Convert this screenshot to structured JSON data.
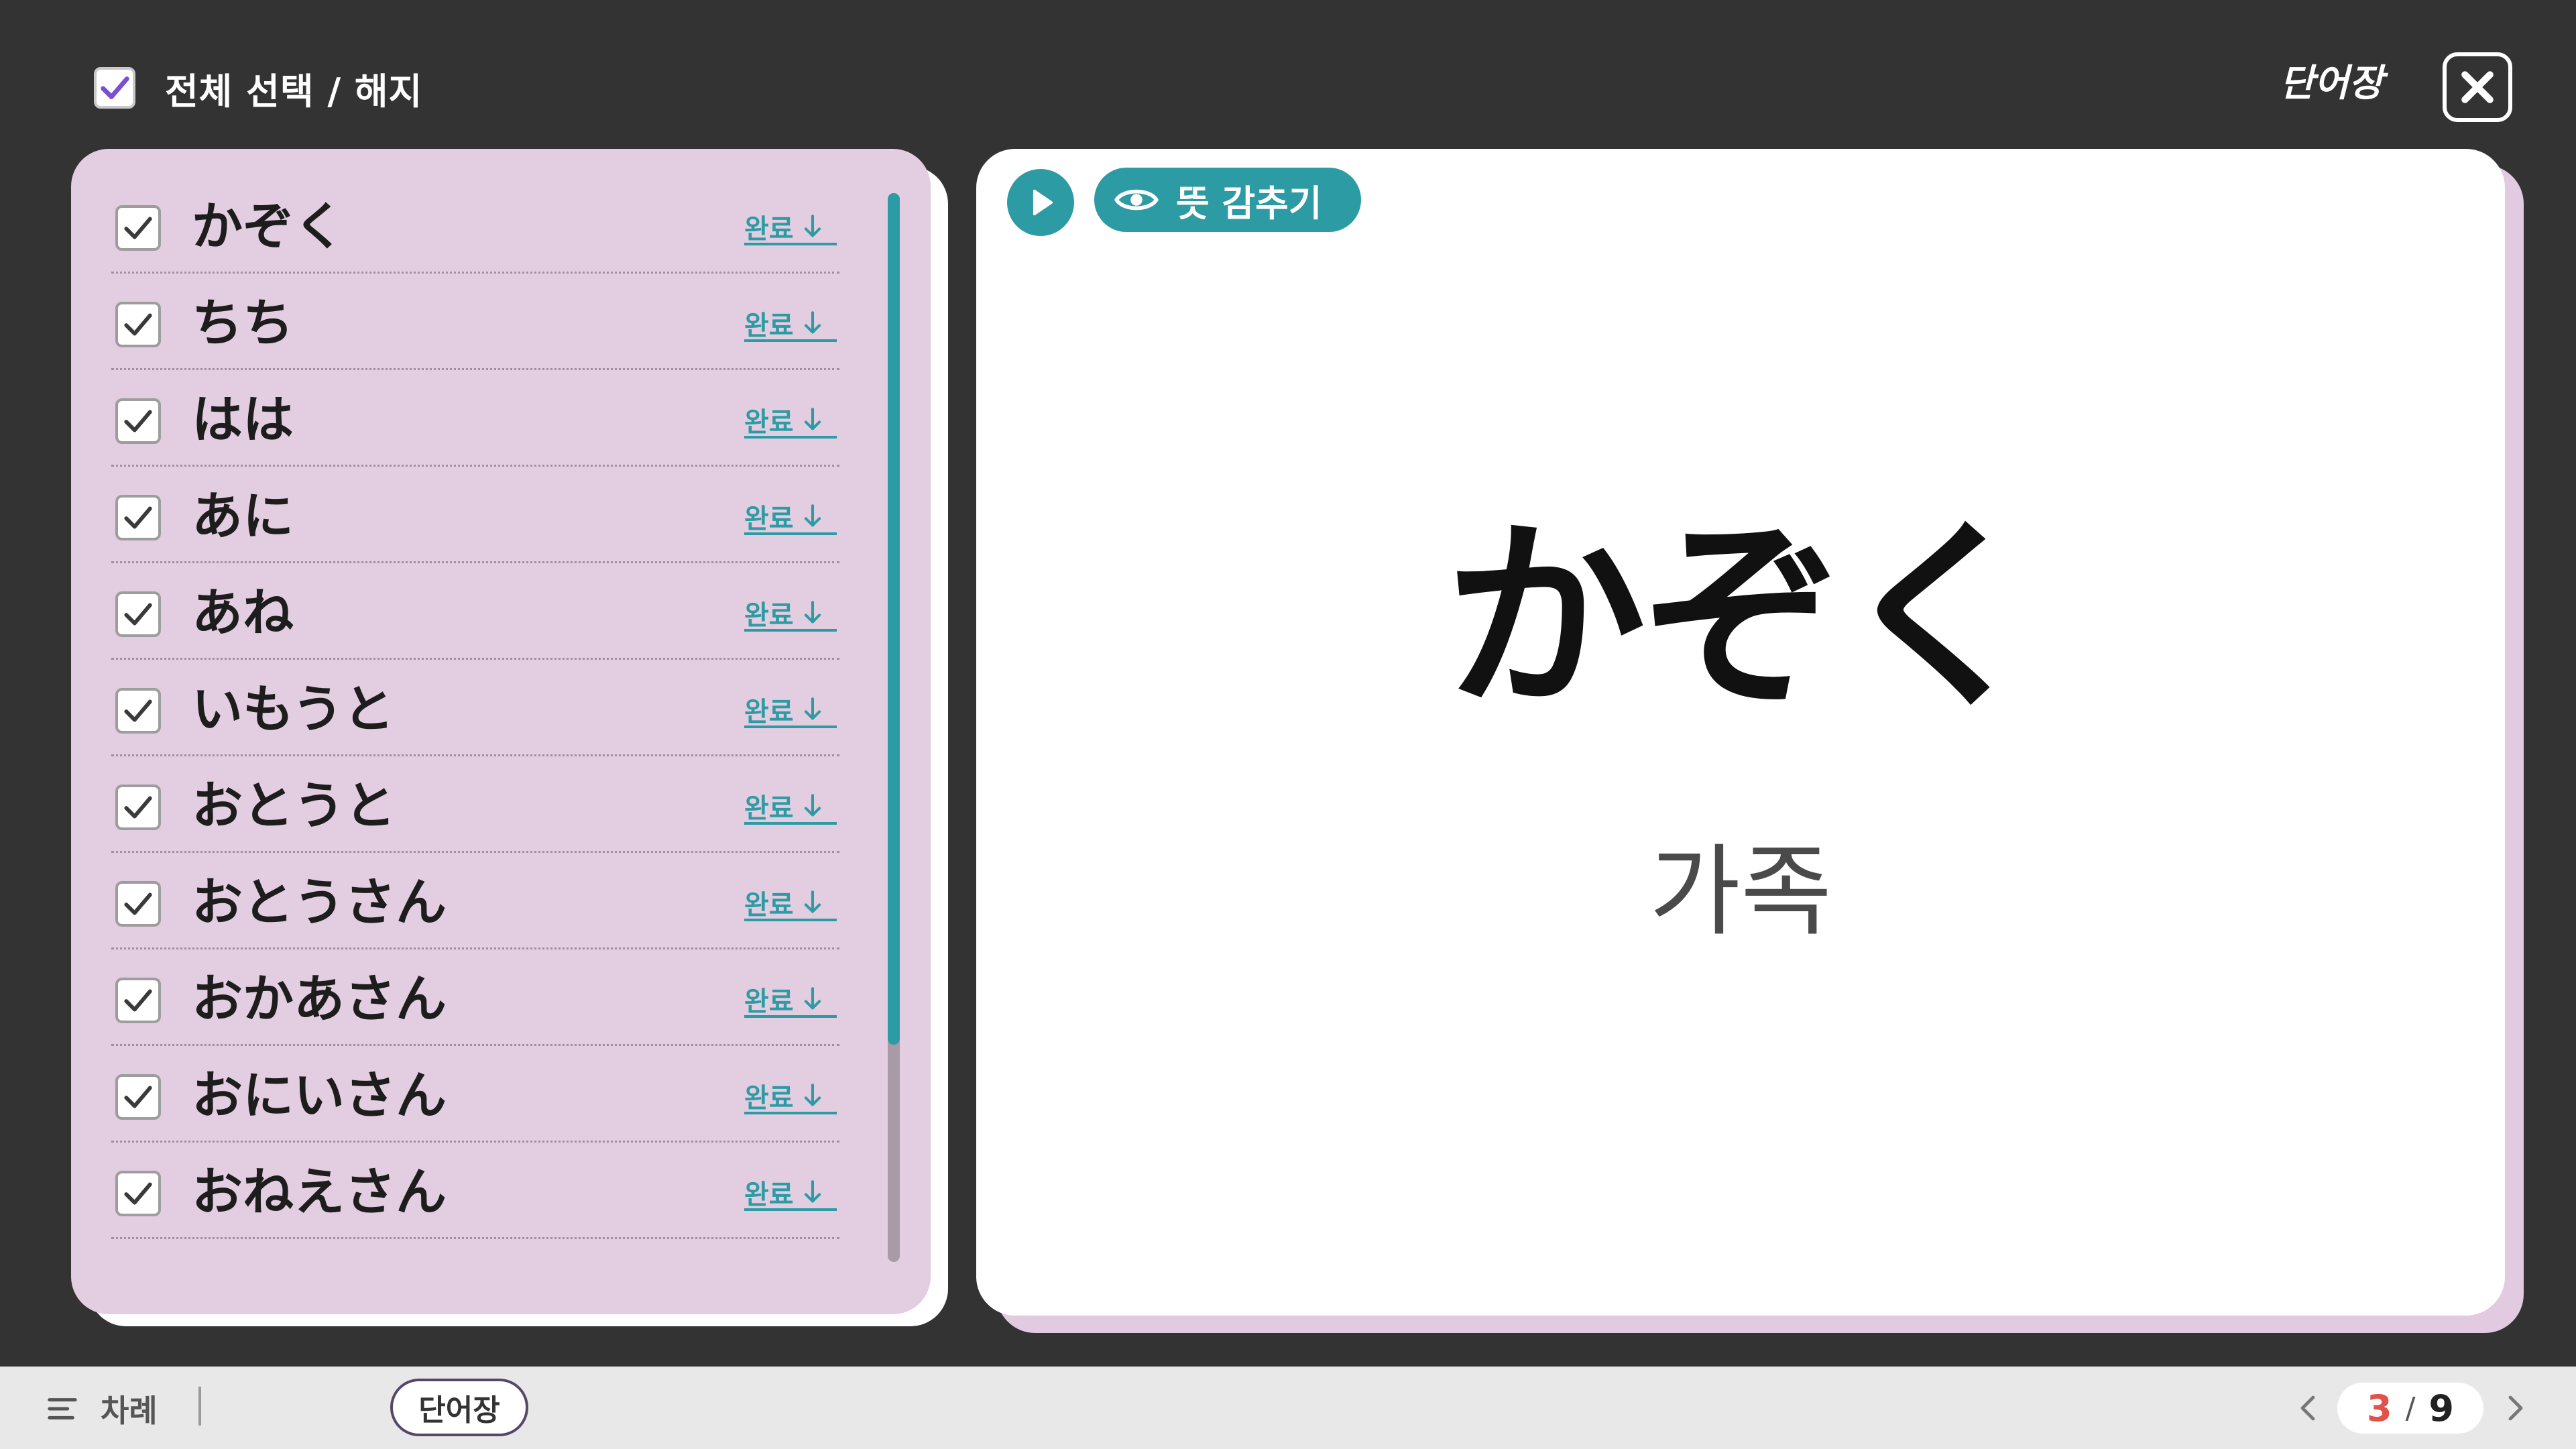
{
  "header": {
    "select_all_label": "전체 선택 / 해지",
    "brand_title": "단어장"
  },
  "word_list": [
    {
      "word": "かぞく",
      "status": "완료",
      "checked": true
    },
    {
      "word": "ちち",
      "status": "완료",
      "checked": true
    },
    {
      "word": "はは",
      "status": "완료",
      "checked": true
    },
    {
      "word": "あに",
      "status": "완료",
      "checked": true
    },
    {
      "word": "あね",
      "status": "완료",
      "checked": true
    },
    {
      "word": "いもうと",
      "status": "완료",
      "checked": true
    },
    {
      "word": "おとうと",
      "status": "완료",
      "checked": true
    },
    {
      "word": "おとうさん",
      "status": "완료",
      "checked": true
    },
    {
      "word": "おかあさん",
      "status": "완료",
      "checked": true
    },
    {
      "word": "おにいさん",
      "status": "완료",
      "checked": true
    },
    {
      "word": "おねえさん",
      "status": "완료",
      "checked": true
    }
  ],
  "card": {
    "hide_meaning_label": "뜻 감추기",
    "term": "かぞく",
    "meaning": "가족"
  },
  "footer": {
    "toc_label": "차례",
    "vocab_button_label": "단어장",
    "page_current": "3",
    "page_separator": "/",
    "page_total": "9"
  },
  "colors": {
    "accent": "#2d9ba4",
    "panel": "#e3cde0",
    "page_current": "#e0524a",
    "check": "#7a4fd0"
  },
  "icons": [
    "check-icon",
    "close-icon",
    "play-icon",
    "eye-icon",
    "arrow-down-icon",
    "menu-icon",
    "chevron-left-icon",
    "chevron-right-icon"
  ]
}
